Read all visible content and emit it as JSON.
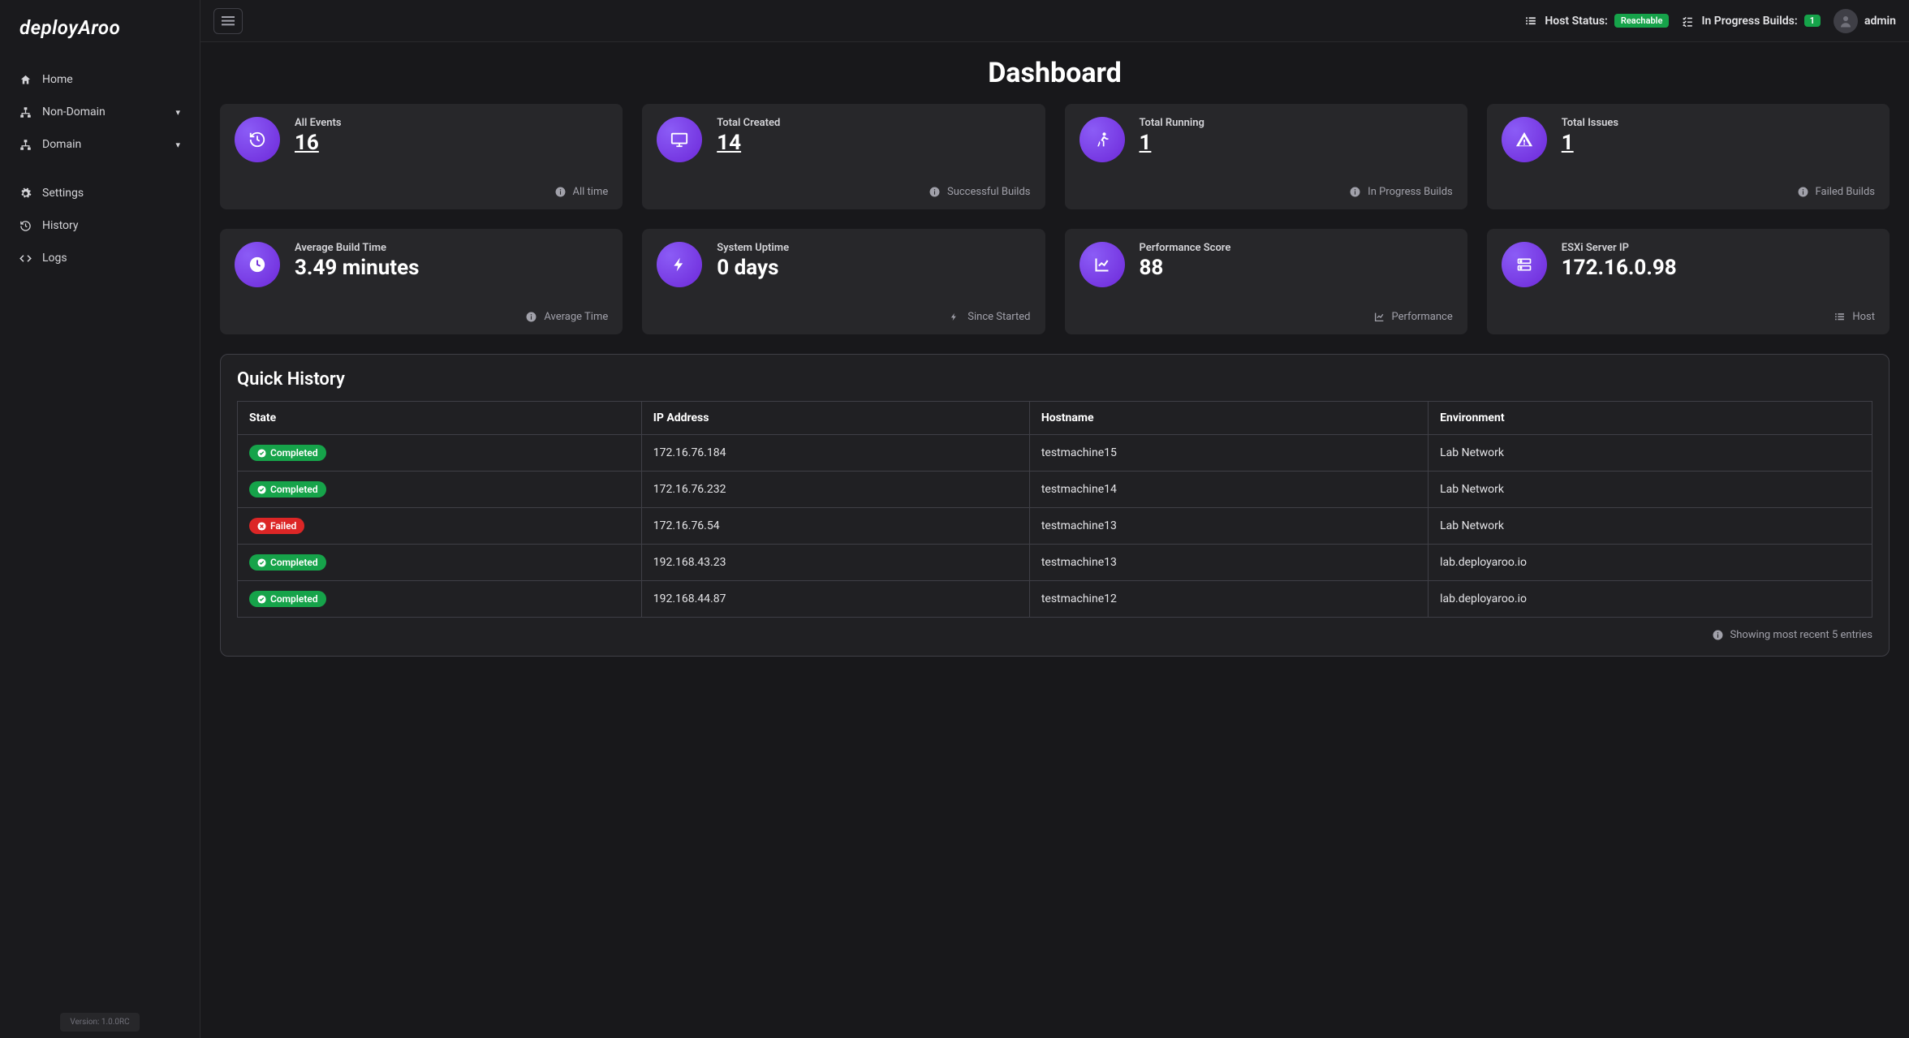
{
  "brand": "deployAroo",
  "version": "Version: 1.0.0RC",
  "nav": {
    "home": "Home",
    "nondomain": "Non-Domain",
    "domain": "Domain",
    "settings": "Settings",
    "history": "History",
    "logs": "Logs"
  },
  "topbar": {
    "host_status_label": "Host Status:",
    "host_status_value": "Reachable",
    "in_progress_label": "In Progress Builds:",
    "in_progress_value": "1",
    "user": "admin"
  },
  "page_title": "Dashboard",
  "cards": [
    {
      "label": "All Events",
      "value": "16",
      "foot": "All time",
      "foot_icon": "info",
      "link": true,
      "icon": "history"
    },
    {
      "label": "Total Created",
      "value": "14",
      "foot": "Successful Builds",
      "foot_icon": "info",
      "link": true,
      "icon": "desktop"
    },
    {
      "label": "Total Running",
      "value": "1",
      "foot": "In Progress Builds",
      "foot_icon": "info",
      "link": true,
      "icon": "running"
    },
    {
      "label": "Total Issues",
      "value": "1",
      "foot": "Failed Builds",
      "foot_icon": "info",
      "link": true,
      "icon": "warning"
    },
    {
      "label": "Average Build Time",
      "value": "3.49 minutes",
      "foot": "Average Time",
      "foot_icon": "info",
      "link": false,
      "icon": "clock"
    },
    {
      "label": "System Uptime",
      "value": "0 days",
      "foot": "Since Started",
      "foot_icon": "bolt",
      "link": false,
      "icon": "bolt"
    },
    {
      "label": "Performance Score",
      "value": "88",
      "foot": "Performance",
      "foot_icon": "chart",
      "link": false,
      "icon": "chart"
    },
    {
      "label": "ESXi Server IP",
      "value": "172.16.0.98",
      "foot": "Host",
      "foot_icon": "list",
      "link": false,
      "icon": "server"
    }
  ],
  "history": {
    "title": "Quick History",
    "columns": [
      "State",
      "IP Address",
      "Hostname",
      "Environment"
    ],
    "rows": [
      {
        "state": "Completed",
        "state_type": "completed",
        "ip": "172.16.76.184",
        "hostname": "testmachine15",
        "env": "Lab Network"
      },
      {
        "state": "Completed",
        "state_type": "completed",
        "ip": "172.16.76.232",
        "hostname": "testmachine14",
        "env": "Lab Network"
      },
      {
        "state": "Failed",
        "state_type": "failed",
        "ip": "172.16.76.54",
        "hostname": "testmachine13",
        "env": "Lab Network"
      },
      {
        "state": "Completed",
        "state_type": "completed",
        "ip": "192.168.43.23",
        "hostname": "testmachine13",
        "env": "lab.deployaroo.io"
      },
      {
        "state": "Completed",
        "state_type": "completed",
        "ip": "192.168.44.87",
        "hostname": "testmachine12",
        "env": "lab.deployaroo.io"
      }
    ],
    "foot": "Showing most recent 5 entries"
  }
}
